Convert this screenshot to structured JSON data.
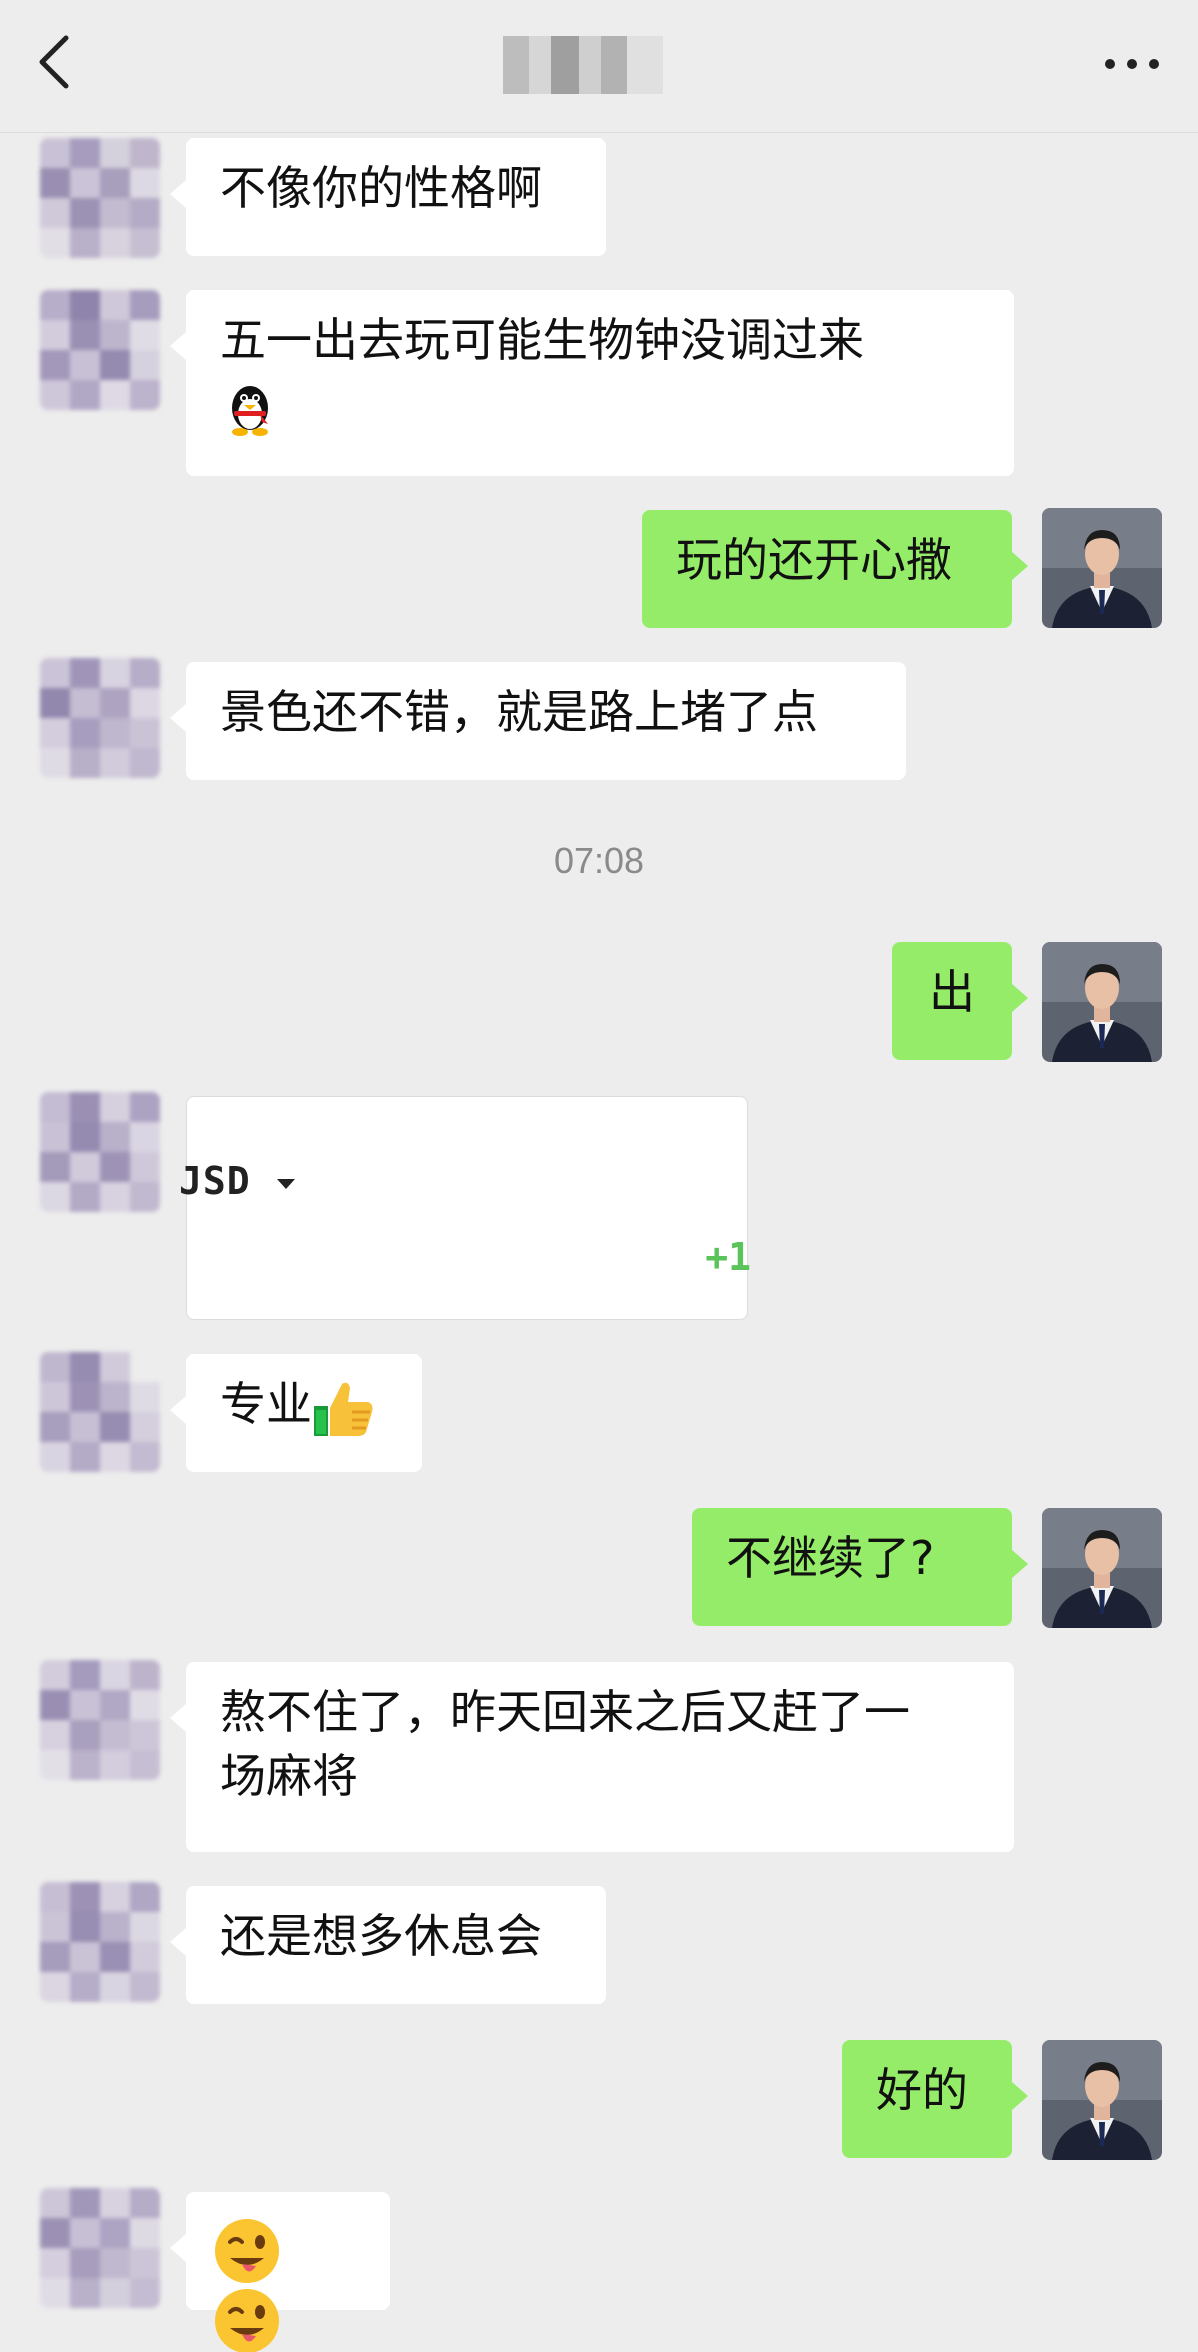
{
  "header": {
    "back_icon": "chevron-left-icon",
    "title": "",
    "more_icon": "more-dots-icon"
  },
  "messages": [
    {
      "side": "in",
      "text": "不像你的性格啊"
    },
    {
      "side": "in",
      "text": "五一出去玩可能生物钟没调过来",
      "emoji": "penguin-emoji"
    },
    {
      "side": "out",
      "text": "玩的还开心撒"
    },
    {
      "side": "in",
      "text": "景色还不错，就是路上堵了点"
    },
    {
      "side": "out",
      "text": "出"
    },
    {
      "side": "in",
      "type": "card",
      "card_label": "JSD",
      "card_right": "+1"
    },
    {
      "side": "in",
      "text": "专业",
      "emoji": "thumbs-up-emoji"
    },
    {
      "side": "out",
      "text": "不继续了?"
    },
    {
      "side": "in",
      "line1": "熬不住了，昨天回来之后又赶了一",
      "line2": "场麻将"
    },
    {
      "side": "in",
      "text": "还是想多休息会"
    },
    {
      "side": "out",
      "text": "好的"
    },
    {
      "side": "in",
      "type": "emoji",
      "emoji": "winking-tongue-emoji-x2"
    }
  ],
  "timestamp": "07:08",
  "colors": {
    "background": "#ededed",
    "incoming_bubble": "#ffffff",
    "outgoing_bubble": "#95ec69",
    "timestamp_text": "#8a8a8a",
    "card_accent": "#5ac35a"
  }
}
